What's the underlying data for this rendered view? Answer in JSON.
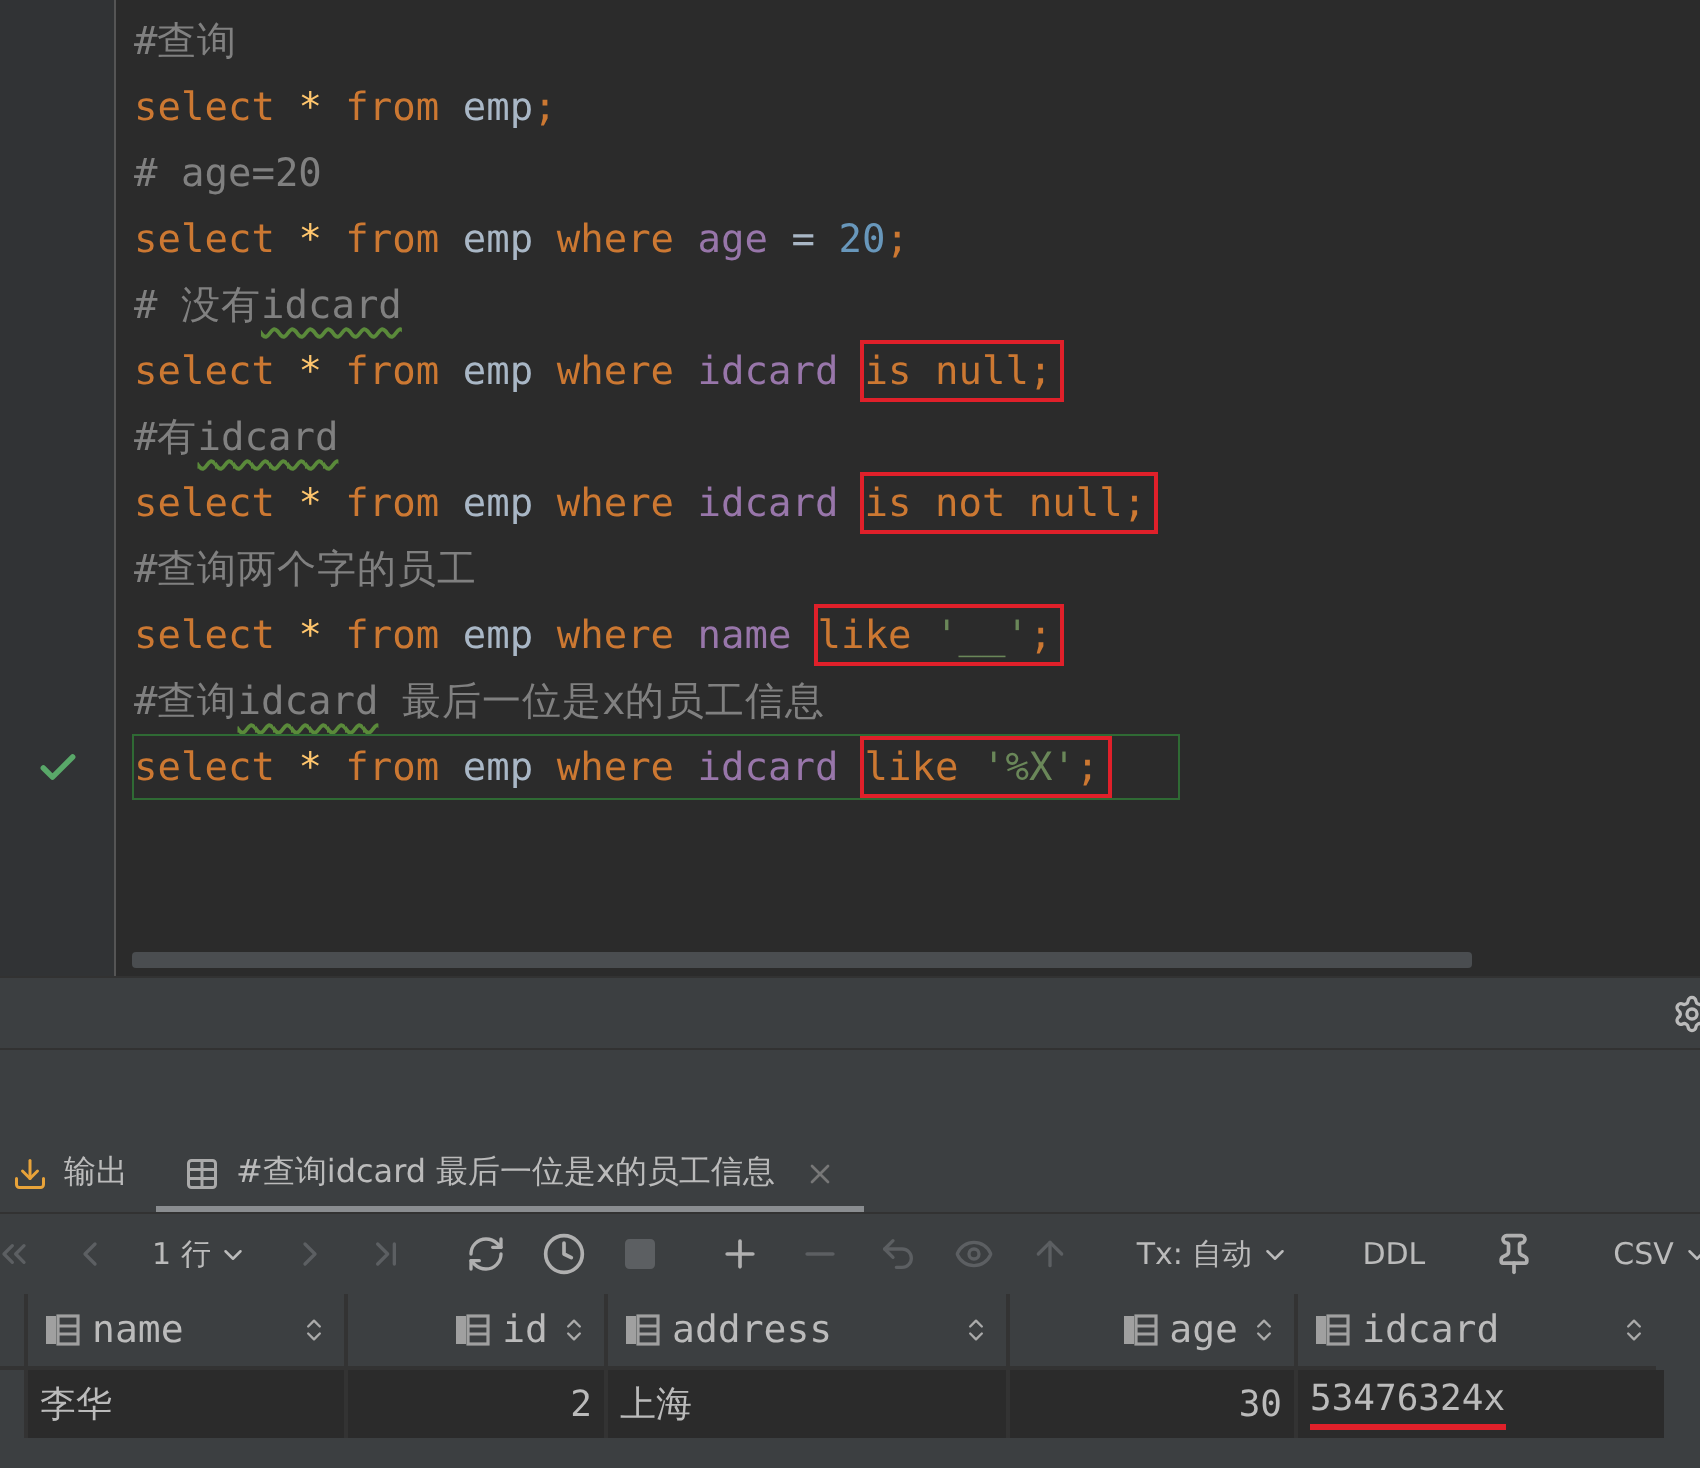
{
  "editor": {
    "lines": [
      {
        "kind": "comment",
        "current": false,
        "tokens": [
          {
            "text": "#查询",
            "kind": "comment"
          }
        ]
      },
      {
        "kind": "code",
        "current": false,
        "tokens": [
          {
            "text": "select",
            "kind": "keyword"
          },
          {
            "text": " *",
            "kind": "star"
          },
          {
            "text": " from",
            "kind": "keyword"
          },
          {
            "text": " emp",
            "kind": "plain"
          },
          {
            "text": ";",
            "kind": "keyword"
          }
        ]
      },
      {
        "kind": "comment",
        "current": false,
        "tokens": [
          {
            "text": "# age=20",
            "kind": "comment"
          }
        ]
      },
      {
        "kind": "code",
        "current": false,
        "tokens": [
          {
            "text": "select",
            "kind": "keyword"
          },
          {
            "text": " *",
            "kind": "star"
          },
          {
            "text": " from",
            "kind": "keyword"
          },
          {
            "text": " emp",
            "kind": "plain"
          },
          {
            "text": " where",
            "kind": "keyword"
          },
          {
            "text": " age",
            "kind": "column"
          },
          {
            "text": " =",
            "kind": "plain"
          },
          {
            "text": " 20",
            "kind": "number"
          },
          {
            "text": ";",
            "kind": "keyword"
          }
        ]
      },
      {
        "kind": "comment",
        "current": false,
        "tokens": [
          {
            "text": "# 没有",
            "kind": "comment"
          },
          {
            "text": "idcard",
            "kind": "typo"
          }
        ]
      },
      {
        "kind": "code",
        "current": false,
        "tokens": [
          {
            "text": "select",
            "kind": "keyword"
          },
          {
            "text": " *",
            "kind": "star"
          },
          {
            "text": " from",
            "kind": "keyword"
          },
          {
            "text": " emp",
            "kind": "plain"
          },
          {
            "text": " where",
            "kind": "keyword"
          },
          {
            "text": " idcard",
            "kind": "column"
          }
        ],
        "boxed_tokens": [
          {
            "text": "is null;",
            "kind": "keyword"
          }
        ]
      },
      {
        "kind": "comment",
        "current": false,
        "tokens": [
          {
            "text": "#有",
            "kind": "comment"
          },
          {
            "text": "idcard",
            "kind": "typo"
          }
        ]
      },
      {
        "kind": "code",
        "current": false,
        "tokens": [
          {
            "text": "select",
            "kind": "keyword"
          },
          {
            "text": " *",
            "kind": "star"
          },
          {
            "text": " from",
            "kind": "keyword"
          },
          {
            "text": " emp",
            "kind": "plain"
          },
          {
            "text": " where",
            "kind": "keyword"
          },
          {
            "text": " idcard",
            "kind": "column"
          }
        ],
        "boxed_tokens": [
          {
            "text": "is not null;",
            "kind": "keyword"
          }
        ]
      },
      {
        "kind": "comment",
        "current": false,
        "tokens": [
          {
            "text": "#查询两个字的员工",
            "kind": "comment"
          }
        ]
      },
      {
        "kind": "code",
        "current": false,
        "tokens": [
          {
            "text": "select",
            "kind": "keyword"
          },
          {
            "text": " *",
            "kind": "star"
          },
          {
            "text": " from",
            "kind": "keyword"
          },
          {
            "text": " emp",
            "kind": "plain"
          },
          {
            "text": " where",
            "kind": "keyword"
          },
          {
            "text": " name",
            "kind": "column"
          }
        ],
        "boxed_tokens": [
          {
            "text": "like",
            "kind": "keyword"
          },
          {
            "text": " '__'",
            "kind": "string"
          },
          {
            "text": ";",
            "kind": "keyword"
          }
        ]
      },
      {
        "kind": "comment",
        "current": false,
        "tokens": [
          {
            "text": "#查询",
            "kind": "comment"
          },
          {
            "text": "idcard",
            "kind": "typo"
          },
          {
            "text": " 最后一位是x的员工信息",
            "kind": "comment"
          }
        ]
      },
      {
        "kind": "code",
        "current": true,
        "tokens": [
          {
            "text": "select",
            "kind": "keyword"
          },
          {
            "text": " *",
            "kind": "star"
          },
          {
            "text": " from",
            "kind": "keyword"
          },
          {
            "text": " emp",
            "kind": "plain"
          },
          {
            "text": " where",
            "kind": "keyword"
          },
          {
            "text": " idcard",
            "kind": "column"
          }
        ],
        "boxed_tokens": [
          {
            "text": "like",
            "kind": "keyword"
          },
          {
            "text": " '%X'",
            "kind": "string"
          },
          {
            "text": ";",
            "kind": "keyword"
          }
        ]
      }
    ]
  },
  "tabs": [
    {
      "label": "输出",
      "kind": "output",
      "selected": false,
      "closable": false
    },
    {
      "label": "#查询idcard 最后一位是x的员工信息",
      "kind": "table",
      "selected": true,
      "closable": true
    }
  ],
  "toolbar": {
    "page": "1 行",
    "tx": "Tx: 自动",
    "ddl": "DDL",
    "export": "CSV"
  },
  "table": {
    "columns": [
      {
        "name": "name",
        "kind": "text"
      },
      {
        "name": "id",
        "kind": "number"
      },
      {
        "name": "address",
        "kind": "text"
      },
      {
        "name": "age",
        "kind": "number"
      },
      {
        "name": "idcard",
        "kind": "text"
      }
    ],
    "rows": [
      {
        "cells": [
          "李华",
          "2",
          "上海",
          "30",
          "53476324x"
        ],
        "underlined": [
          false,
          false,
          false,
          false,
          true
        ]
      }
    ]
  }
}
